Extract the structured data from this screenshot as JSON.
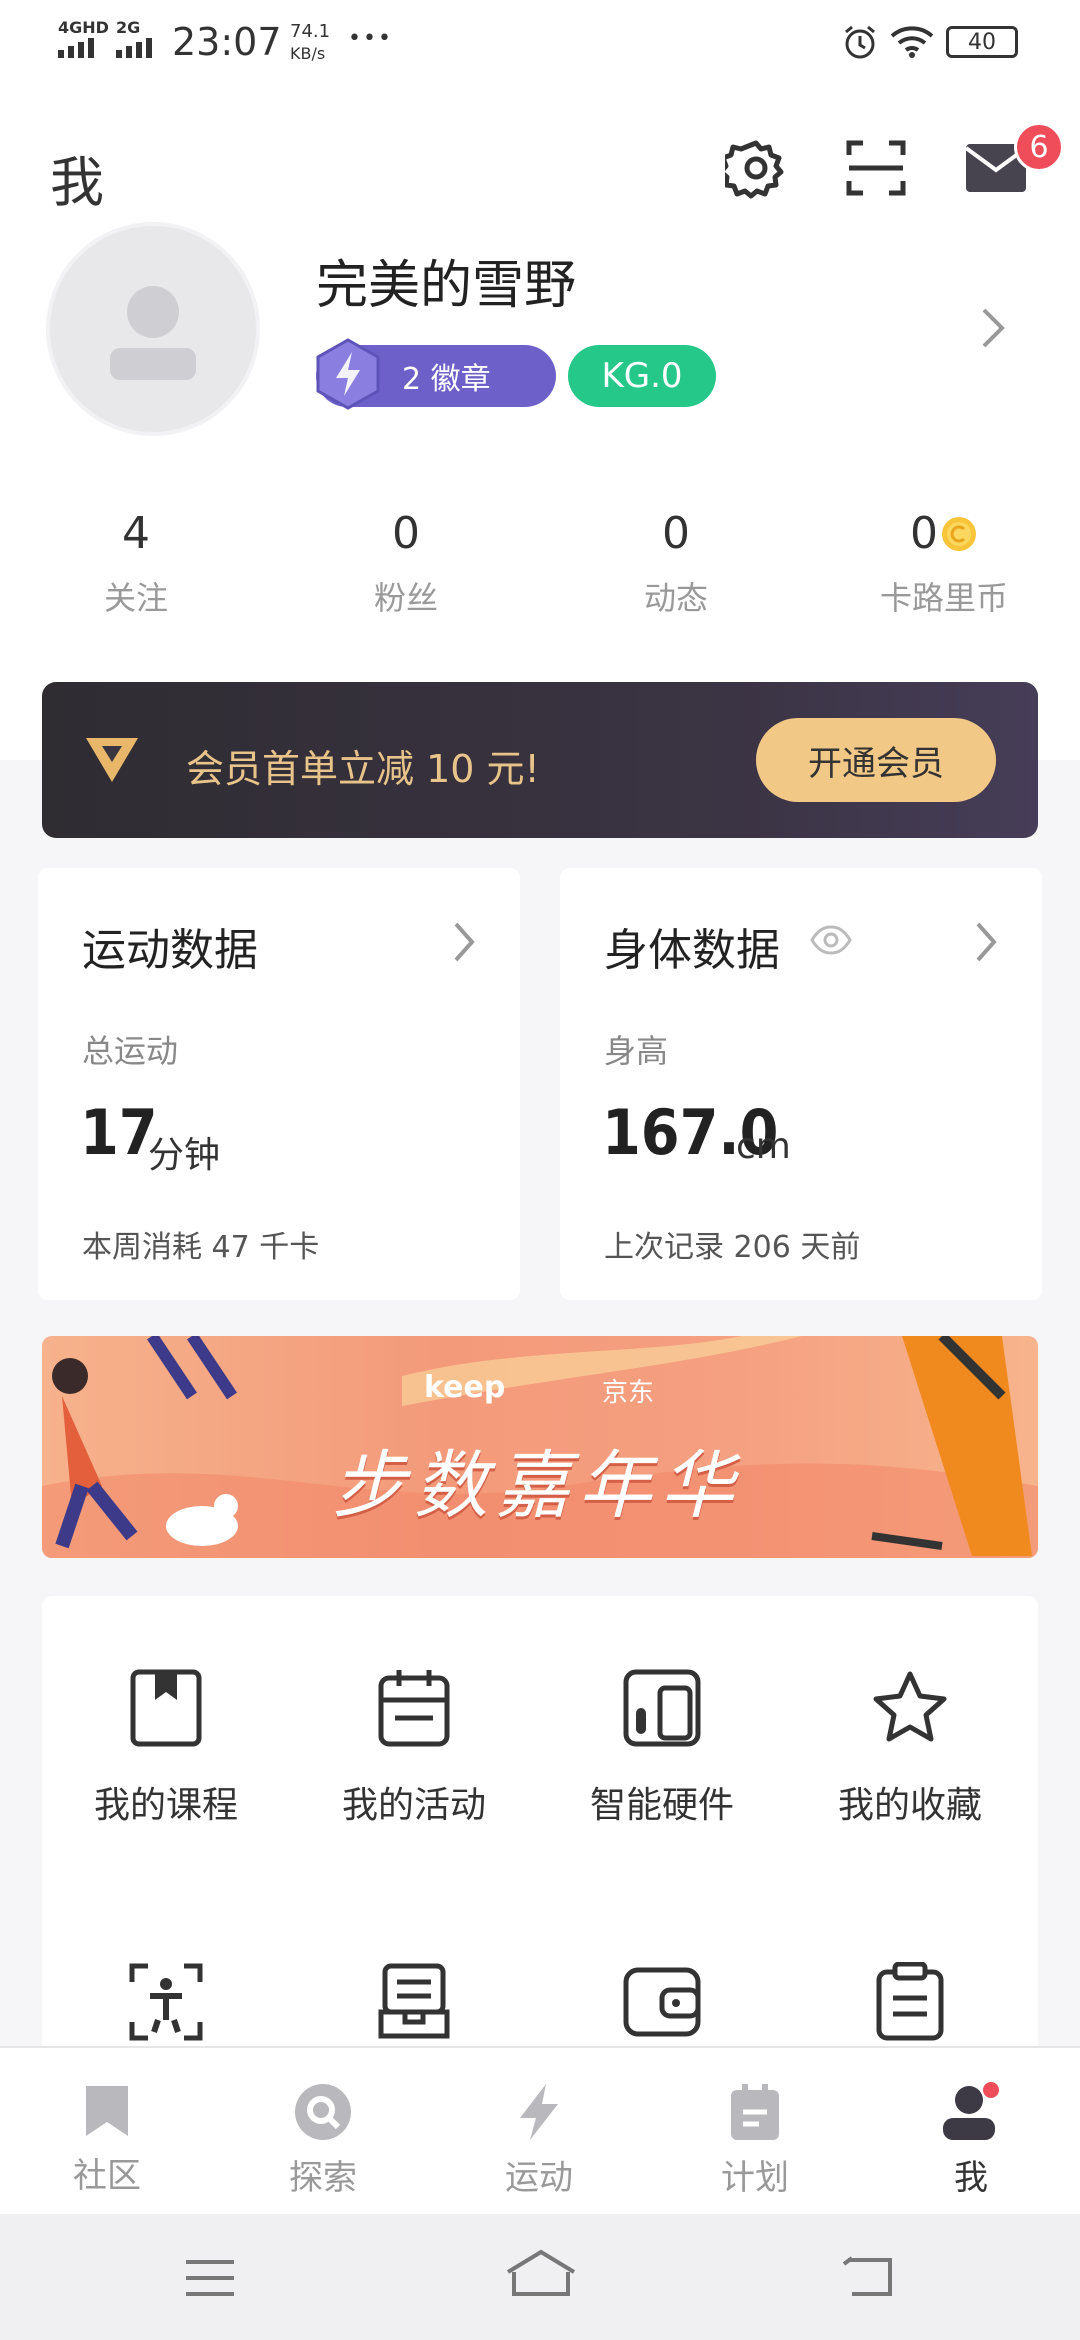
{
  "status_bar": {
    "net1": "4GHD",
    "net2": "2G",
    "time": "23:07",
    "speed_value": "74.1",
    "speed_unit": "KB/s",
    "dots": "•••",
    "battery": "40"
  },
  "header": {
    "title": "我",
    "mail_badge": "6",
    "icons": [
      "gear-icon",
      "scan-icon",
      "mail-icon"
    ]
  },
  "profile": {
    "name": "完美的雪野",
    "badge_label": "2 徽章",
    "kg_label": "KG.0"
  },
  "stats": [
    {
      "value": "4",
      "label": "关注"
    },
    {
      "value": "0",
      "label": "粉丝"
    },
    {
      "value": "0",
      "label": "动态"
    },
    {
      "value": "0",
      "label": "卡路里币"
    }
  ],
  "vip": {
    "text": "会员首单立减 10 元!",
    "button": "开通会员",
    "colors": {
      "text": "#e9c48a",
      "button": "#f1c886"
    }
  },
  "exercise_card": {
    "title": "运动数据",
    "sub": "总运动",
    "value": "17",
    "unit": "分钟",
    "foot": "本周消耗 47 千卡"
  },
  "body_card": {
    "title": "身体数据",
    "sub": "身高",
    "value": "167.0",
    "unit": "cm",
    "foot": "上次记录 206 天前"
  },
  "promo": {
    "brand1": "keep",
    "brand2": "京东",
    "slogan": "步数嘉年华"
  },
  "grid": {
    "row1": [
      {
        "label": "我的课程",
        "icon": "bookmark-book-icon"
      },
      {
        "label": "我的活动",
        "icon": "calendar-icon"
      },
      {
        "label": "智能硬件",
        "icon": "devices-icon"
      },
      {
        "label": "我的收藏",
        "icon": "star-icon"
      }
    ],
    "row2_icons": [
      "body-scan-icon",
      "inbox-icon",
      "wallet-icon",
      "clipboard-icon"
    ]
  },
  "nav": [
    {
      "label": "社区",
      "icon": "bookmark-icon"
    },
    {
      "label": "探索",
      "icon": "search-icon"
    },
    {
      "label": "运动",
      "icon": "lightning-icon"
    },
    {
      "label": "计划",
      "icon": "plan-icon"
    },
    {
      "label": "我",
      "icon": "user-icon"
    }
  ]
}
